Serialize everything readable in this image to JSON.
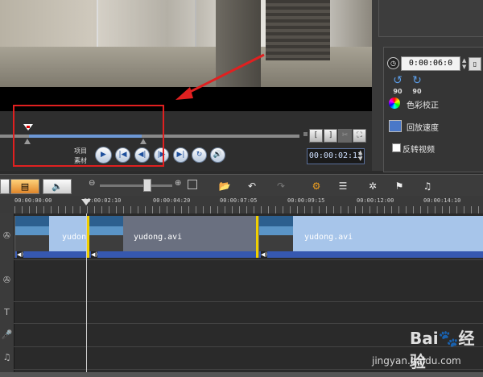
{
  "transport": {
    "label_project": "项目",
    "label_clip": "素材",
    "btn_play": "▶",
    "btn_start": "|◀",
    "btn_prev": "◀|",
    "btn_next": "|▶",
    "btn_end": "▶|",
    "btn_repeat": "↻",
    "btn_volume": "🔊",
    "mark_in": "[",
    "mark_out": "]",
    "timecode": "00:00:02:13",
    "playhead_fraction": 0.09
  },
  "right_panel": {
    "duration": "0:00:06:0",
    "rotate_left_value": "90",
    "rotate_right_value": "90",
    "color_correction_label": "色彩校正",
    "playback_speed_label": "回放速度",
    "reverse_video_label": "反转视频"
  },
  "ruler": {
    "ticks": [
      "00:00:00:00",
      "00:00:02:10",
      "00:00:04:20",
      "00:00:07:05",
      "00:00:09:15",
      "00:00:12:00",
      "00:00:14:10"
    ]
  },
  "clips": [
    {
      "name": "yudong"
    },
    {
      "name": "yudong.avi"
    },
    {
      "name": "yudong.avi"
    }
  ],
  "watermark": {
    "brand": "Bai🐾经验",
    "url": "jingyan.baidu.com"
  },
  "colors": {
    "highlight_box": "#e02020",
    "clip_fill": "#a7c5ea",
    "audio_band": "#3658b0",
    "clip_divider": "#f0d000"
  }
}
